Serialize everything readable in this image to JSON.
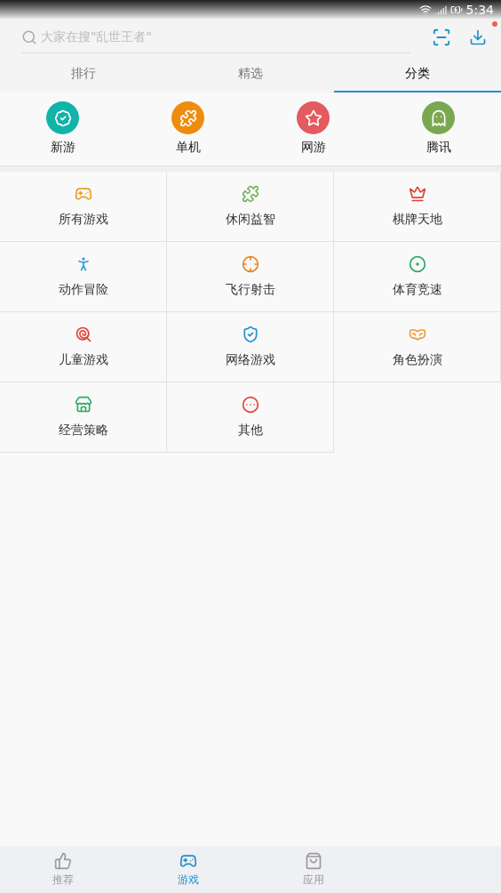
{
  "status_bar": {
    "time": "5:34"
  },
  "search": {
    "placeholder": "大家在搜\"乱世王者\"",
    "download_badge": true
  },
  "tabs": [
    {
      "label": "排行",
      "selected": false
    },
    {
      "label": "精选",
      "selected": false
    },
    {
      "label": "分类",
      "selected": true
    }
  ],
  "quick_links": [
    {
      "label": "新游",
      "color": "#12b3a8"
    },
    {
      "label": "单机",
      "color": "#ef8c0e"
    },
    {
      "label": "网游",
      "color": "#e35a5f"
    },
    {
      "label": "腾讯",
      "color": "#7aa850"
    }
  ],
  "categories": [
    {
      "label": "所有游戏",
      "color": "#e8a02a"
    },
    {
      "label": "休闲益智",
      "color": "#78b05a"
    },
    {
      "label": "棋牌天地",
      "color": "#e0443a"
    },
    {
      "label": "动作冒险",
      "color": "#2a9ee0"
    },
    {
      "label": "飞行射击",
      "color": "#e8802a"
    },
    {
      "label": "体育竞速",
      "color": "#2aa860"
    },
    {
      "label": "儿童游戏",
      "color": "#e0443a"
    },
    {
      "label": "网络游戏",
      "color": "#1f8fd0"
    },
    {
      "label": "角色扮演",
      "color": "#f0963a"
    },
    {
      "label": "经营策略",
      "color": "#2aaa60"
    },
    {
      "label": "其他",
      "color": "#e0443a"
    }
  ],
  "bottom_nav": [
    {
      "label": "推荐",
      "selected": false
    },
    {
      "label": "游戏",
      "selected": true
    },
    {
      "label": "应用",
      "selected": false
    }
  ]
}
